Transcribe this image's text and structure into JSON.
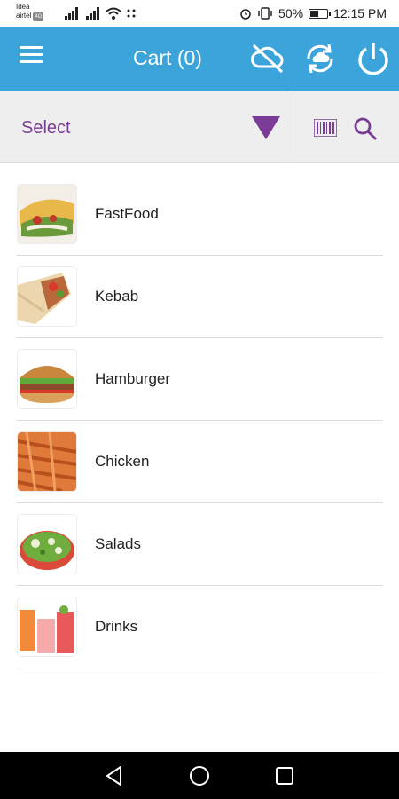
{
  "status_bar": {
    "carrier1": "Idea",
    "carrier2": "airtel",
    "network_badge": "4G",
    "battery_percent": "50%",
    "battery_level": 0.5,
    "time": "12:15 PM",
    "icons": [
      "signal-icon",
      "wifi-icon",
      "alarm-icon",
      "vibrate-icon",
      "battery-icon"
    ]
  },
  "app_bar": {
    "title": "Cart (0)",
    "background": "#3aa4db",
    "icons": [
      "menu-icon",
      "cloud-off-icon",
      "sync-icon",
      "power-icon"
    ]
  },
  "filter": {
    "select_label": "Select",
    "accent": "#7a3c96",
    "icons": [
      "dropdown-arrow-icon",
      "barcode-icon",
      "search-icon"
    ]
  },
  "categories": [
    {
      "name": "FastFood"
    },
    {
      "name": "Kebab"
    },
    {
      "name": "Hamburger"
    },
    {
      "name": "Chicken"
    },
    {
      "name": "Salads"
    },
    {
      "name": "Drinks"
    }
  ],
  "nav_bar": {
    "icons": [
      "back-icon",
      "home-icon",
      "recents-icon"
    ]
  }
}
